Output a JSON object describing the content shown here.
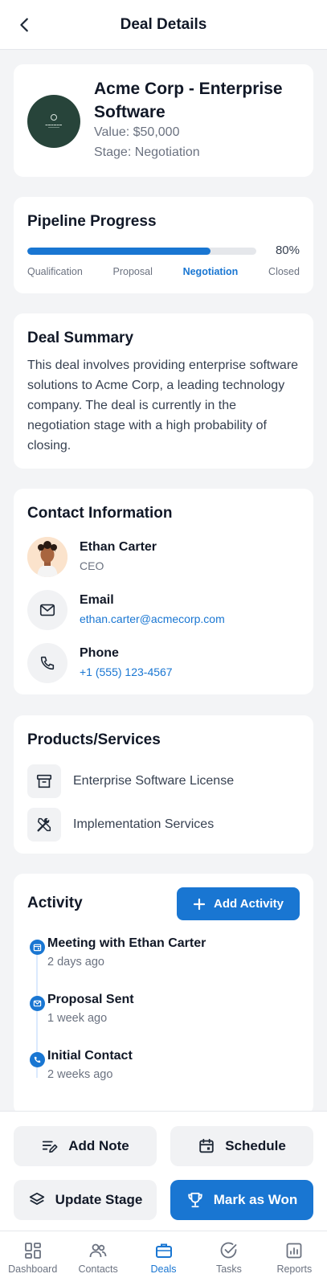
{
  "header": {
    "title": "Deal Details",
    "back_icon": "chevron-left-icon"
  },
  "deal": {
    "name": "Acme Corp - Enterprise Software",
    "value": "Value: $50,000",
    "stage": "Stage: Negotiation"
  },
  "pipeline": {
    "title": "Pipeline Progress",
    "progress_percent": 80,
    "progress_label": "80%",
    "stages": [
      "Qualification",
      "Proposal",
      "Negotiation",
      "Closed"
    ],
    "active_stage": "Negotiation"
  },
  "summary": {
    "title": "Deal Summary",
    "text": "This deal involves providing enterprise software solutions to Acme Corp, a leading technology company. The deal is currently in the negotiation stage with a high probability of closing."
  },
  "contact": {
    "title": "Contact Information",
    "person": {
      "name": "Ethan Carter",
      "role": "CEO"
    },
    "email": {
      "label": "Email",
      "value": "ethan.carter@acmecorp.com"
    },
    "phone": {
      "label": "Phone",
      "value": "+1 (555) 123-4567"
    }
  },
  "products": {
    "title": "Products/Services",
    "items": [
      {
        "label": "Enterprise Software License",
        "icon": "archive-box-icon"
      },
      {
        "label": "Implementation Services",
        "icon": "tools-icon"
      }
    ]
  },
  "activity": {
    "title": "Activity",
    "add_label": "Add Activity",
    "items": [
      {
        "title": "Meeting with Ethan Carter",
        "time": "2 days ago",
        "icon": "calendar-icon"
      },
      {
        "title": "Proposal Sent",
        "time": "1 week ago",
        "icon": "mail-icon"
      },
      {
        "title": "Initial Contact",
        "time": "2 weeks ago",
        "icon": "phone-icon"
      }
    ]
  },
  "actions": {
    "add_note": "Add Note",
    "schedule": "Schedule",
    "update_stage": "Update Stage",
    "mark_won": "Mark as Won"
  },
  "nav": {
    "items": [
      "Dashboard",
      "Contacts",
      "Deals",
      "Tasks",
      "Reports"
    ],
    "active": "Deals"
  },
  "colors": {
    "accent": "#1976d2",
    "background": "#f3f4f6",
    "logo_bg": "#27443a"
  }
}
